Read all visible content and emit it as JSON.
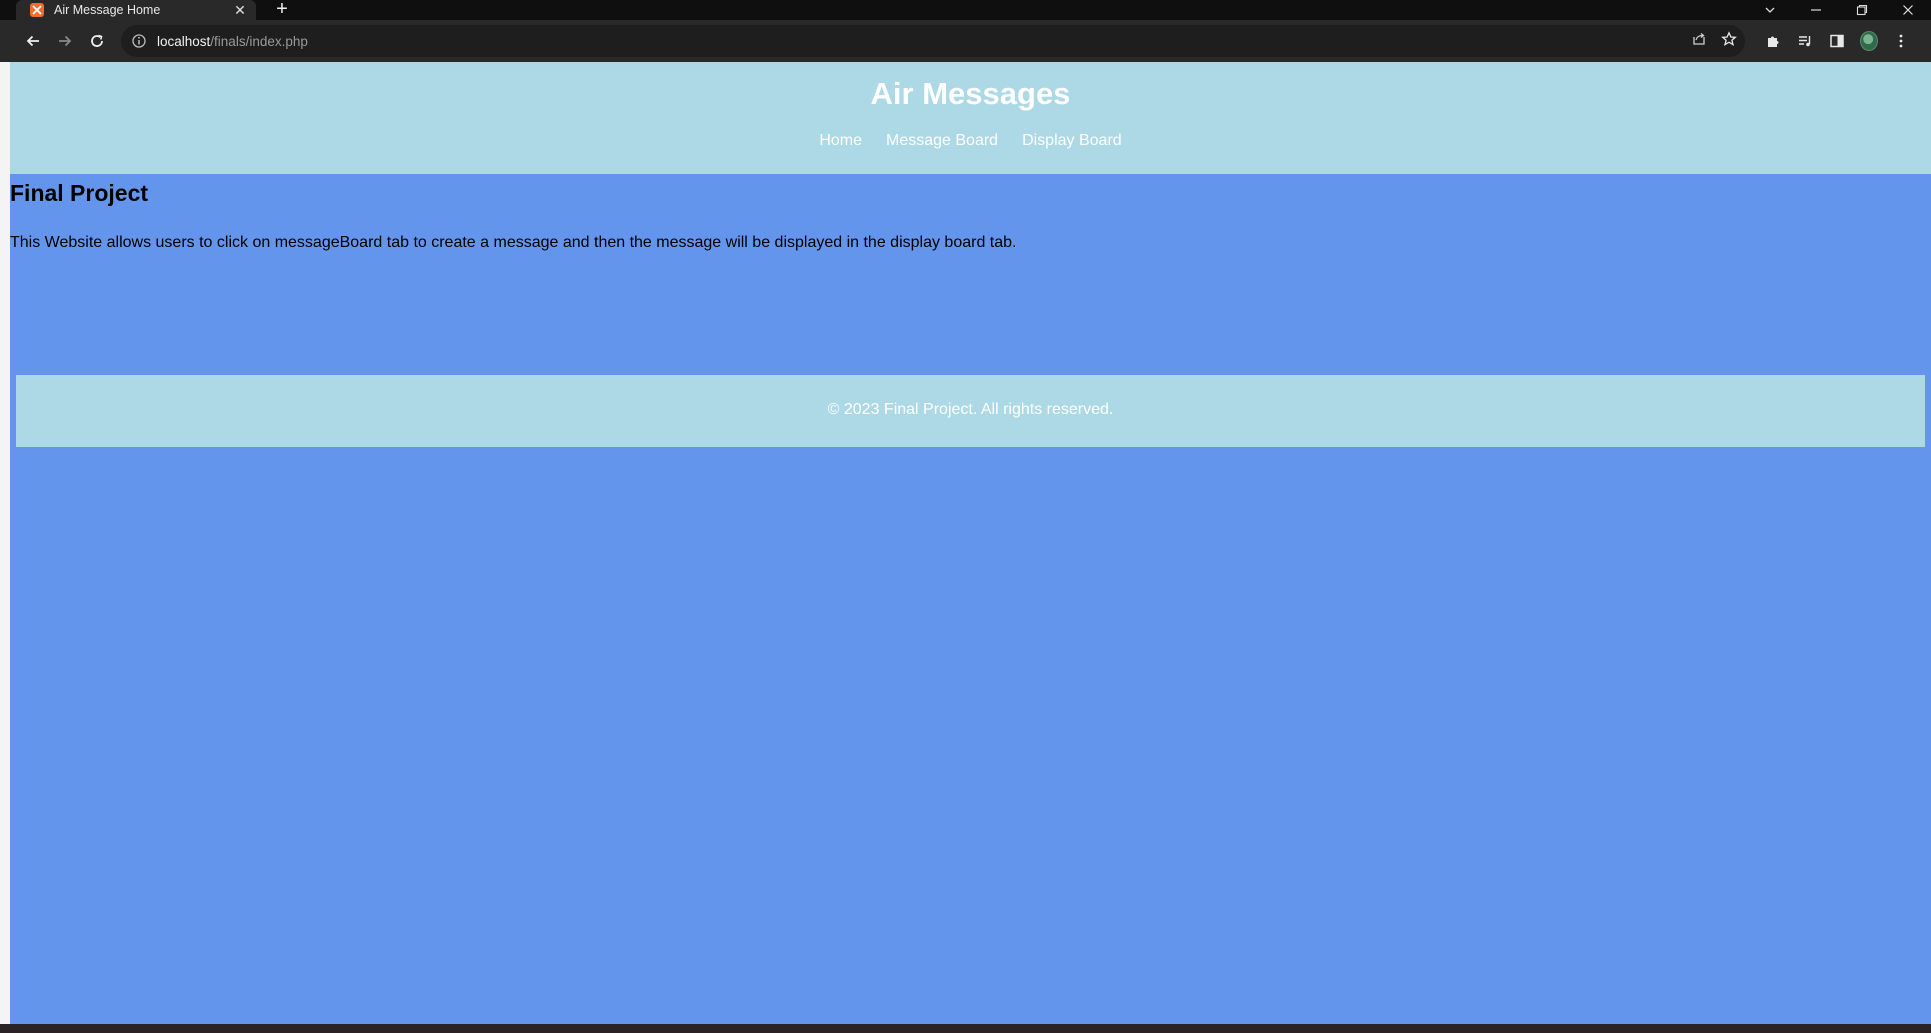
{
  "browser": {
    "tab_title": "Air Message Home",
    "tab_close": "✕",
    "new_tab": "+",
    "url_host": "localhost",
    "url_path": "/finals/index.php"
  },
  "site": {
    "title": "Air Messages",
    "nav": [
      "Home",
      "Message Board",
      "Display Board"
    ],
    "heading": "Final Project",
    "description": "This Website allows users to click on messageBoard tab to create a message and then the message will be displayed in the display board tab.",
    "footer": "© 2023 Final Project. All rights reserved."
  },
  "colors": {
    "header_bg": "#add8e6",
    "page_bg": "#6495ed",
    "text": "#ffffff"
  }
}
